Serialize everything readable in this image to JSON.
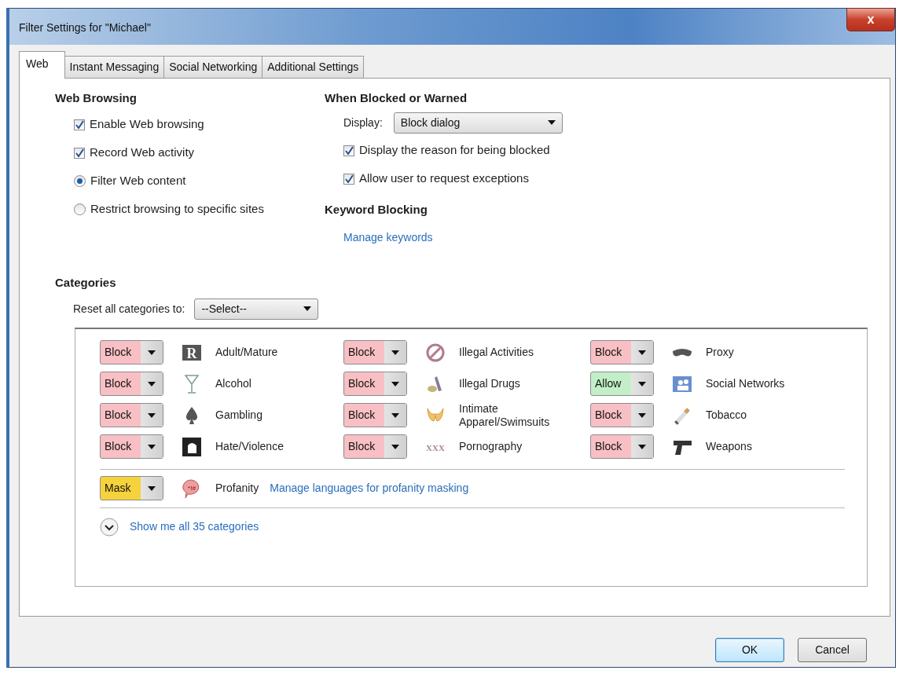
{
  "window": {
    "title": "Filter Settings for \"Michael\"",
    "close": "x"
  },
  "tabs": [
    {
      "label": "Web",
      "selected": true
    },
    {
      "label": "Instant Messaging",
      "selected": false
    },
    {
      "label": "Social Networking",
      "selected": false
    },
    {
      "label": "Additional Settings",
      "selected": false
    }
  ],
  "web_browsing": {
    "heading": "Web Browsing",
    "options": [
      {
        "kind": "checkbox",
        "label": "Enable Web browsing",
        "checked": true
      },
      {
        "kind": "checkbox",
        "label": "Record Web activity",
        "checked": true
      },
      {
        "kind": "radio",
        "label": "Filter Web content",
        "selected": true
      },
      {
        "kind": "radio",
        "label": "Restrict browsing to specific sites",
        "selected": false
      }
    ]
  },
  "when_blocked": {
    "heading": "When Blocked or Warned",
    "display_label": "Display:",
    "display_value": "Block dialog",
    "options": [
      {
        "label": "Display the reason for being blocked",
        "checked": true
      },
      {
        "label": "Allow user to request exceptions",
        "checked": true
      }
    ]
  },
  "keyword_blocking": {
    "heading": "Keyword Blocking",
    "link": "Manage keywords"
  },
  "categories": {
    "heading": "Categories",
    "reset_label": "Reset all categories to:",
    "reset_value": "--Select--",
    "items": [
      {
        "action": "Block",
        "kind": "block",
        "label": "Adult/Mature",
        "icon_text": "R"
      },
      {
        "action": "Block",
        "kind": "block",
        "label": "Alcohol"
      },
      {
        "action": "Block",
        "kind": "block",
        "label": "Gambling"
      },
      {
        "action": "Block",
        "kind": "block",
        "label": "Hate/Violence"
      },
      {
        "action": "Block",
        "kind": "block",
        "label": "Illegal Activities"
      },
      {
        "action": "Block",
        "kind": "block",
        "label": "Illegal Drugs"
      },
      {
        "action": "Block",
        "kind": "block",
        "label": "Intimate Apparel/Swimsuits"
      },
      {
        "action": "Block",
        "kind": "block",
        "label": "Pornography",
        "icon_text": "XXX"
      },
      {
        "action": "Block",
        "kind": "block",
        "label": "Proxy"
      },
      {
        "action": "Allow",
        "kind": "allow",
        "label": "Social Networks"
      },
      {
        "action": "Block",
        "kind": "block",
        "label": "Tobacco"
      },
      {
        "action": "Block",
        "kind": "block",
        "label": "Weapons"
      }
    ],
    "profanity": {
      "action": "Mask",
      "kind": "mask",
      "icon_text": "*!#",
      "label": "Profanity",
      "link": "Manage languages for profanity masking"
    },
    "show_all": "Show me all 35 categories"
  },
  "buttons": [
    "OK",
    "Cancel"
  ]
}
